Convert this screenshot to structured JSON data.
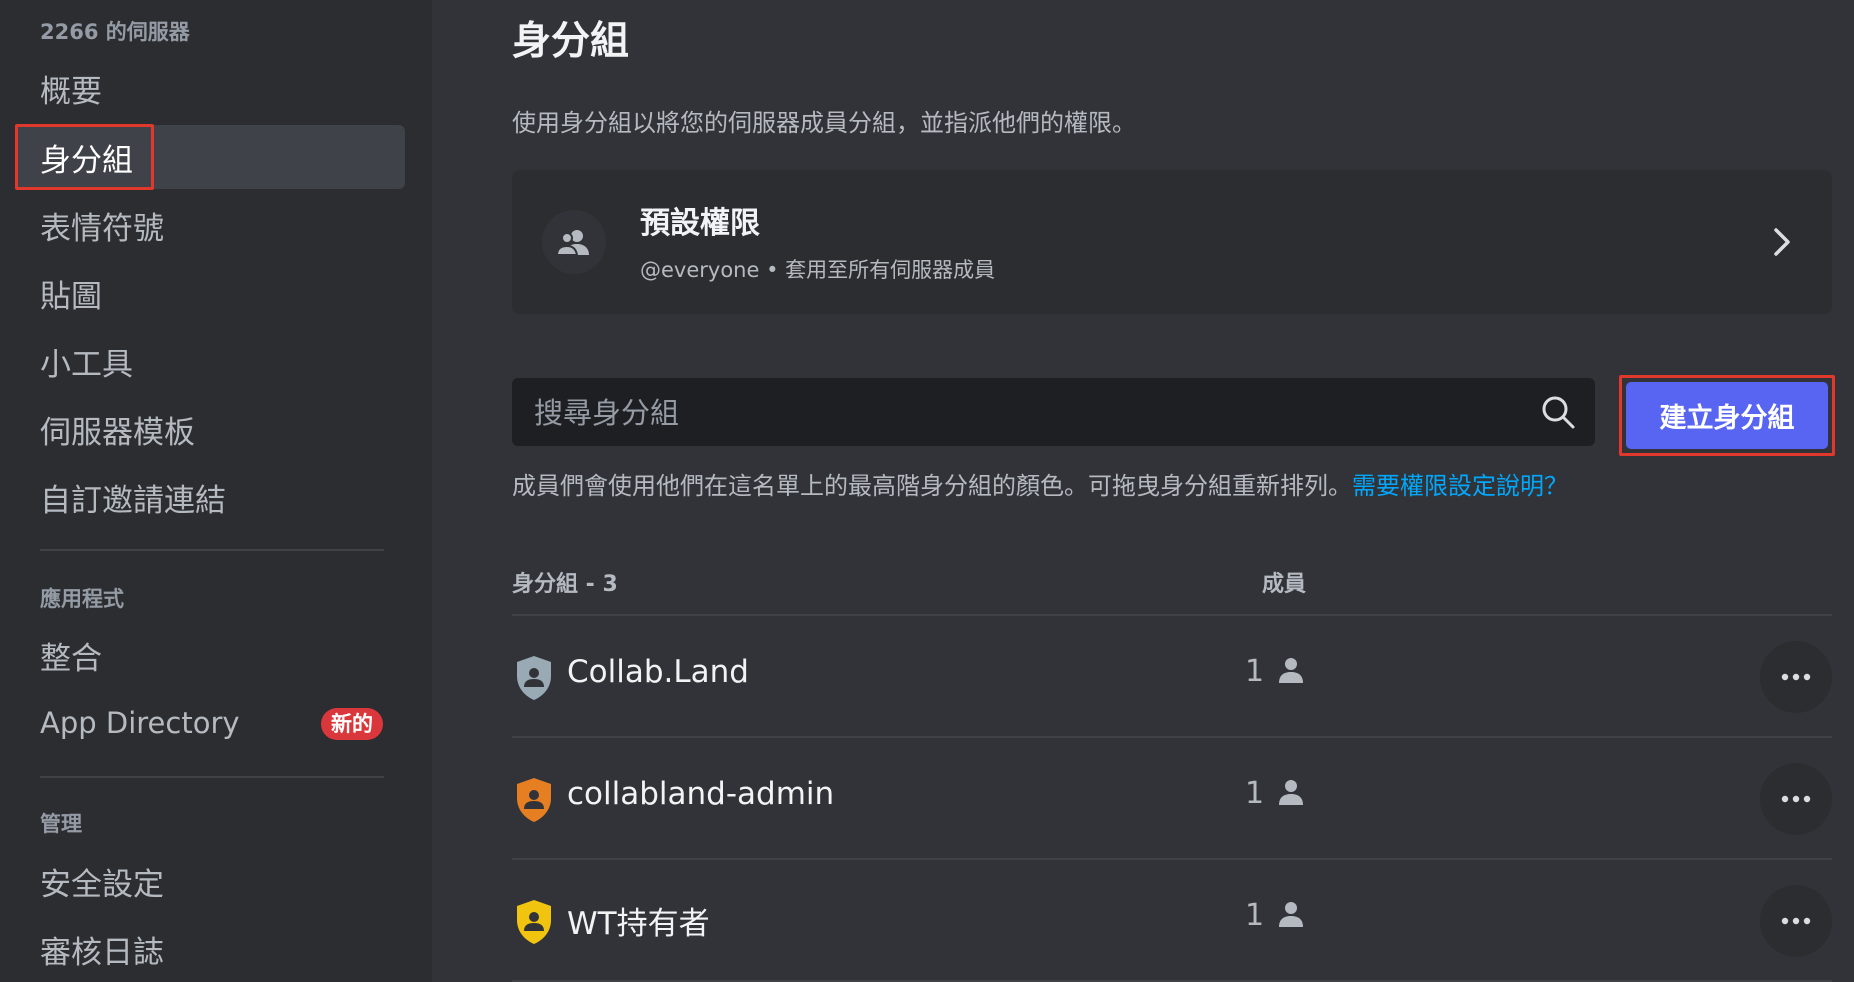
{
  "sidebar": {
    "server_name": "2266 的伺服器",
    "items": [
      {
        "label": "概要"
      },
      {
        "label": "身分組"
      },
      {
        "label": "表情符號"
      },
      {
        "label": "貼圖"
      },
      {
        "label": "小工具"
      },
      {
        "label": "伺服器模板"
      },
      {
        "label": "自訂邀請連結"
      }
    ],
    "apps_section": "應用程式",
    "app_items": [
      {
        "label": "整合"
      },
      {
        "label": "App Directory",
        "badge": "新的"
      }
    ],
    "manage_section": "管理",
    "manage_items": [
      {
        "label": "安全設定"
      },
      {
        "label": "審核日誌"
      }
    ]
  },
  "main": {
    "title": "身分組",
    "description": "使用身分組以將您的伺服器成員分組，並指派他們的權限。",
    "default_permissions": {
      "title": "預設權限",
      "subtitle": "@everyone • 套用至所有伺服器成員"
    },
    "search": {
      "placeholder": "搜尋身分組"
    },
    "create_button": "建立身分組",
    "hint_text": "成員們會使用他們在這名單上的最高階身分組的顏色。可拖曳身分組重新排列。",
    "hint_link": "需要權限設定說明？",
    "table": {
      "roles_header": "身分組 - 3",
      "members_header": "成員",
      "rows": [
        {
          "name": "Collab.Land",
          "members": "1",
          "color": "#99aab5"
        },
        {
          "name": "collabland-admin",
          "members": "1",
          "color": "#e67e22"
        },
        {
          "name": "WT持有者",
          "members": "1",
          "color": "#f1c40f"
        }
      ]
    }
  },
  "colors": {
    "accent": "#5865f2",
    "link": "#00a8fc",
    "highlight": "#e0392b",
    "badge": "#da373c"
  }
}
